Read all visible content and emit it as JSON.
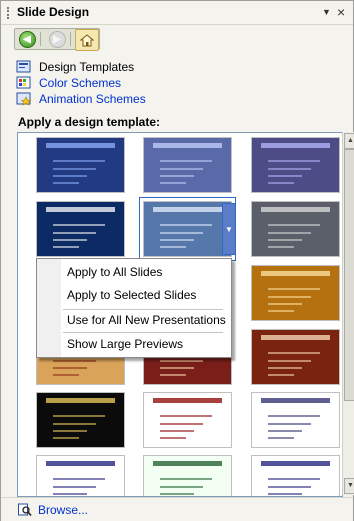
{
  "title_bar": {
    "title": "Slide Design",
    "dropdown_glyph": "▼",
    "close_glyph": "×"
  },
  "navigation": {
    "back": {
      "icon": "back-arrow-icon",
      "glyph": "◀",
      "enabled": true
    },
    "forward": {
      "icon": "forward-arrow-icon",
      "glyph": "▶",
      "enabled": false
    },
    "home": {
      "icon": "home-icon"
    }
  },
  "task_links": [
    {
      "label": "Design Templates",
      "icon": "design-templates-icon"
    },
    {
      "label": "Color Schemes",
      "icon": "color-schemes-icon"
    },
    {
      "label": "Animation Schemes",
      "icon": "animation-schemes-icon"
    }
  ],
  "gallery": {
    "heading": "Apply a design template:",
    "thumbnails": [
      {
        "bg": "#213a82",
        "accent": "#8fb0ff"
      },
      {
        "bg": "#5a6aa8",
        "accent": "#c7d1ff"
      },
      {
        "bg": "#4d4c86",
        "accent": "#b8b8ff"
      },
      {
        "bg": "#0c2a63",
        "accent": "#ffffff"
      },
      {
        "bg": "#5577aa",
        "accent": "#e8f0ff"
      },
      {
        "bg": "#5a5f6a",
        "accent": "#dddddd"
      },
      {
        "bg": "#ffffff",
        "accent": "#333333"
      },
      {
        "bg": "#3c4c5c",
        "accent": "#ffffff"
      },
      {
        "bg": "#b5700f",
        "accent": "#ffe6a6"
      },
      {
        "bg": "#d9a35a",
        "accent": "#8a2a10"
      },
      {
        "bg": "#7a1e1a",
        "accent": "#ffdcb0"
      },
      {
        "bg": "#7a2310",
        "accent": "#ffe0c0"
      },
      {
        "bg": "#0b0b0b",
        "accent": "#f2d35c"
      },
      {
        "bg": "#ffffff",
        "accent": "#8b0000"
      },
      {
        "bg": "#ffffff",
        "accent": "#2a2a6a"
      },
      {
        "bg": "#ffffff",
        "accent": "#1a1a7a"
      },
      {
        "bg": "#f2fff2",
        "accent": "#1a5a2a"
      },
      {
        "bg": "#ffffff",
        "accent": "#1a1a7a"
      }
    ]
  },
  "context_menu": {
    "items": [
      "Apply to All Slides",
      "Apply to Selected Slides",
      "Use for All New Presentations",
      "Show Large Previews"
    ]
  },
  "footer": {
    "browse_label": "Browse...",
    "icon": "browse-icon"
  },
  "colors": {
    "link": "#0033cc",
    "selection": "#316ac5",
    "pane_bg": "#f4f3ee"
  }
}
